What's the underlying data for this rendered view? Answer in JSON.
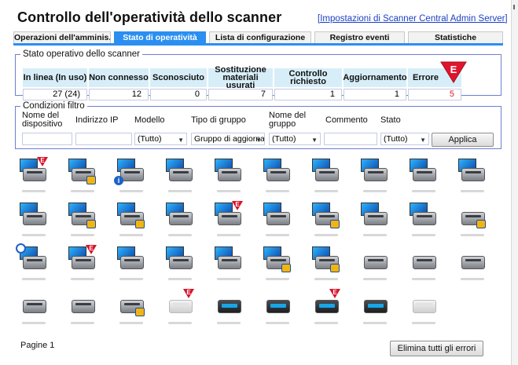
{
  "header": {
    "title": "Controllo dell'operatività dello scanner",
    "settings_link": "[Impostazioni di Scanner Central Admin Server]"
  },
  "tabs": [
    {
      "label": "Operazioni dell'amminis...",
      "active": false
    },
    {
      "label": "Stato di operatività",
      "active": true
    },
    {
      "label": "Lista di configurazione",
      "active": false
    },
    {
      "label": "Registro eventi",
      "active": false
    },
    {
      "label": "Statistiche",
      "active": false
    }
  ],
  "status_panel": {
    "legend": "Stato operativo dello scanner",
    "columns": [
      {
        "header": "In linea (In uso)",
        "value": "27 (24)"
      },
      {
        "header": "Non connesso",
        "value": "12"
      },
      {
        "header": "Sconosciuto",
        "value": "0"
      },
      {
        "header": "Sostituzione materiali usurati",
        "value": "7"
      },
      {
        "header": "Controllo richiesto",
        "value": "1"
      },
      {
        "header": "Aggiornamento",
        "value": "1"
      },
      {
        "header": "Errore",
        "value": "5",
        "highlight": true
      }
    ],
    "error_marker_letter": "E"
  },
  "filter_panel": {
    "legend": "Condizioni filtro",
    "labels": {
      "device_name": "Nome del dispositivo",
      "ip_address": "Indirizzo IP",
      "model": "Modello",
      "group_type": "Tipo di gruppo",
      "group_name": "Nome del gruppo",
      "comment": "Commento",
      "status": "Stato"
    },
    "values": {
      "model": "(Tutto)",
      "group_type": "Gruppo di aggiorna",
      "group_name": "(Tutto)",
      "status": "(Tutto)"
    },
    "apply_button": "Applica"
  },
  "scanner_grid": {
    "rows": [
      [
        {
          "kind": "pc",
          "badge": "error"
        },
        {
          "kind": "pc",
          "badge": "update"
        },
        {
          "kind": "pc",
          "badge": "info"
        },
        {
          "kind": "pc",
          "badge": "none"
        },
        {
          "kind": "pc",
          "badge": "none"
        },
        {
          "kind": "pc",
          "badge": "none"
        },
        {
          "kind": "pc",
          "badge": "none"
        },
        {
          "kind": "pc",
          "badge": "none"
        },
        {
          "kind": "pc",
          "badge": "none"
        },
        {
          "kind": "pc",
          "badge": "none"
        }
      ],
      [
        {
          "kind": "pc",
          "badge": "none"
        },
        {
          "kind": "pc",
          "badge": "update"
        },
        {
          "kind": "pc",
          "badge": "update"
        },
        {
          "kind": "pc",
          "badge": "none"
        },
        {
          "kind": "pc",
          "badge": "error"
        },
        {
          "kind": "pc",
          "badge": "none"
        },
        {
          "kind": "pc",
          "badge": "update"
        },
        {
          "kind": "pc",
          "badge": "none"
        },
        {
          "kind": "pc",
          "badge": "none"
        },
        {
          "kind": "scanner",
          "badge": "update"
        }
      ],
      [
        {
          "kind": "pc",
          "badge": "clock"
        },
        {
          "kind": "pc",
          "badge": "error"
        },
        {
          "kind": "pc",
          "badge": "none"
        },
        {
          "kind": "pc",
          "badge": "none"
        },
        {
          "kind": "pc",
          "badge": "none"
        },
        {
          "kind": "pc",
          "badge": "update"
        },
        {
          "kind": "pc",
          "badge": "update"
        },
        {
          "kind": "scanner",
          "badge": "none"
        },
        {
          "kind": "scanner",
          "badge": "none"
        },
        {
          "kind": "scanner",
          "badge": "none"
        }
      ],
      [
        {
          "kind": "scanner",
          "badge": "none"
        },
        {
          "kind": "scanner",
          "badge": "none"
        },
        {
          "kind": "scanner",
          "badge": "update"
        },
        {
          "kind": "scanner-grey",
          "badge": "error"
        },
        {
          "kind": "scanner-black",
          "badge": "none"
        },
        {
          "kind": "scanner-black",
          "badge": "none"
        },
        {
          "kind": "scanner-black",
          "badge": "error"
        },
        {
          "kind": "scanner-black",
          "badge": "none"
        },
        {
          "kind": "scanner-grey",
          "badge": "none"
        }
      ]
    ]
  },
  "footer": {
    "pager": "Pagine 1",
    "clear_errors_button": "Elimina tutti gli errori"
  },
  "colors": {
    "accent": "#2a8ff0",
    "header_cell": "#d7eef8",
    "error": "#e0142c",
    "link": "#1a3fc4"
  }
}
